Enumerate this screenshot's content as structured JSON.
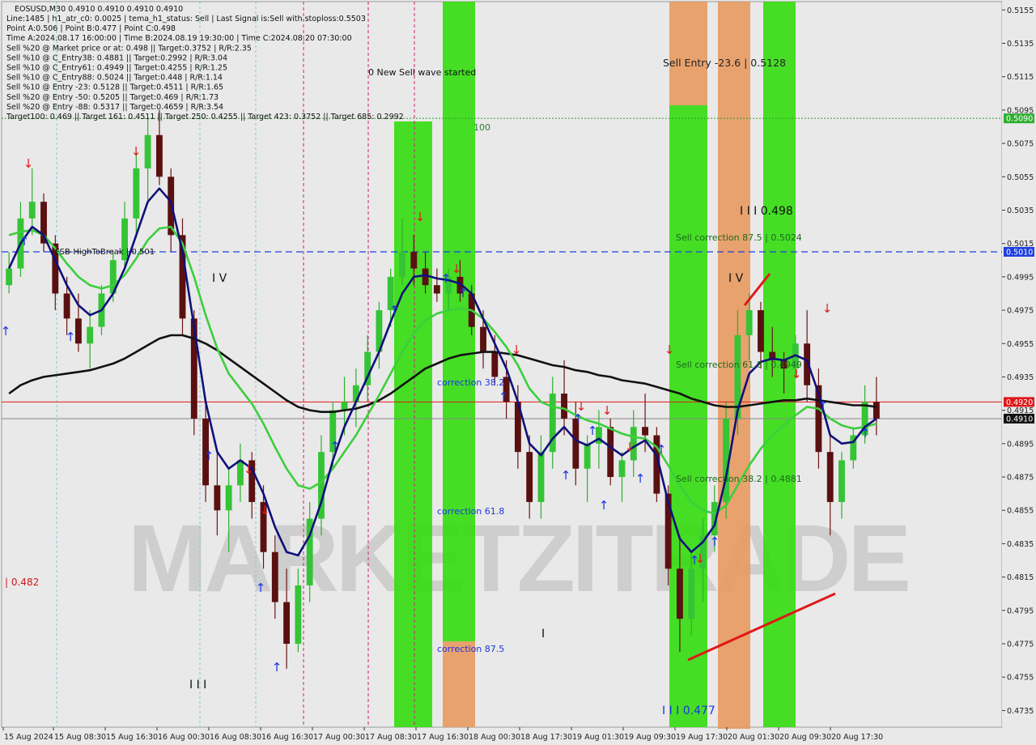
{
  "info": {
    "symbol_line": "EOSUSD,M30  0.4910 0.4910 0.4910 0.4910",
    "lines": [
      "Line:1485  |  h1_atr_c0: 0.0025  |  tema_h1_status: Sell  |  Last Signal is:Sell with stoploss:0.5503",
      "Point A:0.506  |  Point B:0.477  |  Point C:0.498",
      "Time A:2024.08.17 16:00:00  |  Time B:2024.08.19 19:30:00  |  Time C:2024.08.20 07:30:00",
      "Sell %20 @ Market price or at: 0.498  ||  Target:0.3752  |  R/R:2.35",
      "Sell %10 @ C_Entry38: 0.4881  ||  Target:0.2992  |  R/R:3.04",
      "Sell %10 @ C_Entry61: 0.4949  ||  Target:0.4255  |  R/R:1.25",
      "Sell %10 @ C_Entry88: 0.5024  ||  Target:0.448  |  R/R:1.14",
      "Sell %10 @ Entry -23: 0.5128  ||  Target:0.4511  |  R/R:1.65",
      "Sell %20 @ Entry -50: 0.5205  ||  Target:0.469  |  R/R:1.73",
      "Sell %20 @ Entry -88: 0.5317  ||  Target:0.4659  |  R/R:3.54",
      "Target100: 0.469  ||  Target 161: 0.4511  ||  Target 250: 0.4255  ||  Target 423: 0.3752  ||  Target 685: 0.2992"
    ]
  },
  "annotations": {
    "new_wave": "0 New Sell wave started",
    "sell_entry": "Sell Entry -23.6 | 0.5128",
    "label_100": "100",
    "wave_iii_high": "I I I 0.498",
    "sell_corr_875": "Sell correction 87.5 | 0.5024",
    "iv_left": "I V",
    "iv_right": "I V",
    "sell_corr_618": "Sell correction 61.8 | 0.4949",
    "sell_corr_382": "Sell correction 38.2 | 0.4881",
    "fsb_high": "FSB-HighToBreak | 0.501",
    "corr_382": "correction 38.2",
    "corr_618": "correction 61.8",
    "corr_875": "correction 87.5",
    "left_482": "| 0.482",
    "iii_left": "I I I",
    "iii_bottom": "I I I 0.477",
    "i_mark": "I",
    "watermark": "MARKETZITRADE"
  },
  "chart_data": {
    "type": "candlestick",
    "symbol": "EOSUSD",
    "timeframe": "M30",
    "ylim": [
      0.4725,
      0.516
    ],
    "y_ticks": [
      "0.5155",
      "0.5135",
      "0.5115",
      "0.5095",
      "0.5075",
      "0.5055",
      "0.5035",
      "0.5015",
      "0.4995",
      "0.4975",
      "0.4955",
      "0.4935",
      "0.4915",
      "0.4895",
      "0.4875",
      "0.4855",
      "0.4835",
      "0.4815",
      "0.4795",
      "0.4775",
      "0.4755",
      "0.4735"
    ],
    "x_ticks": [
      "15 Aug 2024",
      "15 Aug 08:30",
      "15 Aug 16:30",
      "16 Aug 00:30",
      "16 Aug 08:30",
      "16 Aug 16:30",
      "17 Aug 00:30",
      "17 Aug 08:30",
      "17 Aug 16:30",
      "18 Aug 00:30",
      "18 Aug 17:30",
      "19 Aug 01:30",
      "19 Aug 09:30",
      "19 Aug 17:30",
      "20 Aug 01:30",
      "20 Aug 09:30",
      "20 Aug 17:30"
    ],
    "price_tags": [
      {
        "text": "0.5090",
        "value": 0.509,
        "bg": "#2fae2f"
      },
      {
        "text": "0.5010",
        "value": 0.501,
        "bg": "#1f3fe0"
      },
      {
        "text": "0.4920",
        "value": 0.492,
        "bg": "#e01818"
      },
      {
        "text": "0.4910",
        "value": 0.491,
        "bg": "#111111"
      }
    ],
    "levels": [
      {
        "name": "level-0.5090",
        "value": 0.509,
        "color": "#2e9b2e",
        "style": "dotted"
      },
      {
        "name": "fsb-high-line",
        "value": 0.501,
        "color": "#1f3fe0",
        "style": "dashed"
      },
      {
        "name": "level-0.4920",
        "value": 0.492,
        "color": "#e01818",
        "style": "solid"
      },
      {
        "name": "level-0.4910",
        "value": 0.491,
        "color": "#888888",
        "style": "solid"
      }
    ],
    "candles": [
      [
        0.499,
        0.501,
        0.4985,
        0.5
      ],
      [
        0.5,
        0.504,
        0.4995,
        0.503
      ],
      [
        0.503,
        0.506,
        0.502,
        0.504
      ],
      [
        0.504,
        0.5045,
        0.501,
        0.5015
      ],
      [
        0.5015,
        0.502,
        0.4975,
        0.4985
      ],
      [
        0.4985,
        0.4995,
        0.496,
        0.497
      ],
      [
        0.497,
        0.4985,
        0.495,
        0.4955
      ],
      [
        0.4955,
        0.4975,
        0.494,
        0.4965
      ],
      [
        0.4965,
        0.499,
        0.496,
        0.4985
      ],
      [
        0.4985,
        0.501,
        0.498,
        0.5005
      ],
      [
        0.5005,
        0.504,
        0.5,
        0.503
      ],
      [
        0.503,
        0.507,
        0.502,
        0.506
      ],
      [
        0.506,
        0.509,
        0.504,
        0.508
      ],
      [
        0.508,
        0.5095,
        0.505,
        0.5055
      ],
      [
        0.5055,
        0.506,
        0.501,
        0.502
      ],
      [
        0.502,
        0.503,
        0.496,
        0.497
      ],
      [
        0.497,
        0.4975,
        0.49,
        0.491
      ],
      [
        0.491,
        0.492,
        0.486,
        0.487
      ],
      [
        0.487,
        0.489,
        0.484,
        0.4855
      ],
      [
        0.4855,
        0.488,
        0.483,
        0.487
      ],
      [
        0.487,
        0.4895,
        0.486,
        0.4885
      ],
      [
        0.4885,
        0.489,
        0.485,
        0.486
      ],
      [
        0.486,
        0.487,
        0.482,
        0.483
      ],
      [
        0.483,
        0.484,
        0.479,
        0.48
      ],
      [
        0.48,
        0.482,
        0.476,
        0.4775
      ],
      [
        0.4775,
        0.482,
        0.477,
        0.481
      ],
      [
        0.481,
        0.486,
        0.48,
        0.485
      ],
      [
        0.485,
        0.49,
        0.484,
        0.489
      ],
      [
        0.489,
        0.492,
        0.488,
        0.4915
      ],
      [
        0.4915,
        0.4935,
        0.49,
        0.492
      ],
      [
        0.492,
        0.494,
        0.4905,
        0.493
      ],
      [
        0.493,
        0.496,
        0.492,
        0.495
      ],
      [
        0.495,
        0.498,
        0.494,
        0.4975
      ],
      [
        0.4975,
        0.5,
        0.4965,
        0.4995
      ],
      [
        0.4995,
        0.503,
        0.499,
        0.501
      ],
      [
        0.501,
        0.502,
        0.499,
        0.5
      ],
      [
        0.5,
        0.501,
        0.4985,
        0.499
      ],
      [
        0.499,
        0.5,
        0.498,
        0.4985
      ],
      [
        0.4985,
        0.5,
        0.4975,
        0.4995
      ],
      [
        0.4995,
        0.5005,
        0.498,
        0.4985
      ],
      [
        0.4985,
        0.499,
        0.496,
        0.4965
      ],
      [
        0.4965,
        0.4975,
        0.494,
        0.495
      ],
      [
        0.495,
        0.496,
        0.493,
        0.4935
      ],
      [
        0.4935,
        0.4945,
        0.491,
        0.492
      ],
      [
        0.492,
        0.493,
        0.488,
        0.489
      ],
      [
        0.489,
        0.49,
        0.485,
        0.486
      ],
      [
        0.486,
        0.49,
        0.485,
        0.489
      ],
      [
        0.489,
        0.4935,
        0.488,
        0.4925
      ],
      [
        0.4925,
        0.4945,
        0.49,
        0.491
      ],
      [
        0.491,
        0.492,
        0.487,
        0.488
      ],
      [
        0.488,
        0.49,
        0.486,
        0.4895
      ],
      [
        0.4895,
        0.4915,
        0.488,
        0.4905
      ],
      [
        0.4905,
        0.491,
        0.487,
        0.4875
      ],
      [
        0.4875,
        0.489,
        0.486,
        0.4885
      ],
      [
        0.4885,
        0.4915,
        0.4875,
        0.4905
      ],
      [
        0.4905,
        0.4925,
        0.489,
        0.49
      ],
      [
        0.49,
        0.4905,
        0.486,
        0.4865
      ],
      [
        0.4865,
        0.487,
        0.481,
        0.482
      ],
      [
        0.482,
        0.484,
        0.477,
        0.479
      ],
      [
        0.479,
        0.483,
        0.478,
        0.482
      ],
      [
        0.482,
        0.485,
        0.48,
        0.484
      ],
      [
        0.484,
        0.487,
        0.483,
        0.486
      ],
      [
        0.486,
        0.492,
        0.485,
        0.491
      ],
      [
        0.491,
        0.4975,
        0.49,
        0.496
      ],
      [
        0.496,
        0.4985,
        0.4945,
        0.4975
      ],
      [
        0.4975,
        0.498,
        0.494,
        0.495
      ],
      [
        0.495,
        0.4965,
        0.4935,
        0.4945
      ],
      [
        0.4945,
        0.495,
        0.4925,
        0.494
      ],
      [
        0.494,
        0.496,
        0.4935,
        0.4955
      ],
      [
        0.4955,
        0.4975,
        0.492,
        0.493
      ],
      [
        0.493,
        0.494,
        0.488,
        0.489
      ],
      [
        0.489,
        0.49,
        0.484,
        0.486
      ],
      [
        0.486,
        0.489,
        0.485,
        0.4885
      ],
      [
        0.4885,
        0.4905,
        0.488,
        0.49
      ],
      [
        0.49,
        0.493,
        0.4895,
        0.492
      ],
      [
        0.492,
        0.4935,
        0.49,
        0.491
      ]
    ],
    "ema_fast_dark_blue": [
      0.5,
      0.5015,
      0.5025,
      0.502,
      0.5005,
      0.499,
      0.4978,
      0.4972,
      0.4975,
      0.4985,
      0.5,
      0.502,
      0.504,
      0.5048,
      0.504,
      0.501,
      0.4965,
      0.492,
      0.489,
      0.488,
      0.4885,
      0.488,
      0.4865,
      0.4845,
      0.483,
      0.4828,
      0.484,
      0.486,
      0.4885,
      0.4905,
      0.492,
      0.4935,
      0.495,
      0.4968,
      0.4985,
      0.4995,
      0.4996,
      0.4994,
      0.4993,
      0.4991,
      0.4985,
      0.497,
      0.4955,
      0.494,
      0.492,
      0.4895,
      0.4888,
      0.4898,
      0.4905,
      0.4897,
      0.4894,
      0.4898,
      0.4893,
      0.4888,
      0.4893,
      0.4897,
      0.4888,
      0.486,
      0.4838,
      0.483,
      0.4836,
      0.4846,
      0.4875,
      0.4915,
      0.4937,
      0.4944,
      0.4946,
      0.4945,
      0.4948,
      0.4945,
      0.4925,
      0.49,
      0.4895,
      0.4896,
      0.4905,
      0.491
    ],
    "ema_mid_green": [
      0.502,
      0.5022,
      0.5023,
      0.502,
      0.5012,
      0.5003,
      0.4995,
      0.499,
      0.4988,
      0.499,
      0.4996,
      0.5006,
      0.5017,
      0.5024,
      0.5025,
      0.5015,
      0.4995,
      0.4972,
      0.4952,
      0.4937,
      0.4928,
      0.4919,
      0.4907,
      0.4893,
      0.488,
      0.487,
      0.4868,
      0.4872,
      0.488,
      0.489,
      0.49,
      0.4912,
      0.4924,
      0.4937,
      0.495,
      0.4961,
      0.4969,
      0.4973,
      0.4975,
      0.4976,
      0.4975,
      0.497,
      0.4962,
      0.4953,
      0.4942,
      0.4928,
      0.492,
      0.4917,
      0.4916,
      0.4912,
      0.4909,
      0.4907,
      0.4904,
      0.4901,
      0.4899,
      0.4898,
      0.4893,
      0.4882,
      0.487,
      0.486,
      0.4855,
      0.4853,
      0.4858,
      0.487,
      0.4882,
      0.4892,
      0.49,
      0.4906,
      0.4912,
      0.4917,
      0.4916,
      0.491,
      0.4906,
      0.4904,
      0.4905,
      0.4907
    ],
    "sma_slow_black": [
      0.4925,
      0.493,
      0.4933,
      0.4935,
      0.4936,
      0.4937,
      0.4938,
      0.4939,
      0.4941,
      0.4943,
      0.4946,
      0.495,
      0.4954,
      0.4958,
      0.496,
      0.496,
      0.4958,
      0.4955,
      0.4951,
      0.4946,
      0.4941,
      0.4936,
      0.4931,
      0.4926,
      0.4921,
      0.4917,
      0.4915,
      0.4914,
      0.4914,
      0.4915,
      0.4916,
      0.4918,
      0.4921,
      0.4925,
      0.493,
      0.4935,
      0.494,
      0.4943,
      0.4946,
      0.4948,
      0.4949,
      0.495,
      0.495,
      0.4949,
      0.4948,
      0.4946,
      0.4944,
      0.4942,
      0.4941,
      0.4939,
      0.4938,
      0.4936,
      0.4935,
      0.4933,
      0.4932,
      0.4931,
      0.4929,
      0.4927,
      0.4925,
      0.4922,
      0.492,
      0.4918,
      0.4917,
      0.4917,
      0.4918,
      0.4919,
      0.492,
      0.4921,
      0.4921,
      0.4922,
      0.4921,
      0.492,
      0.4919,
      0.4918,
      0.4918,
      0.4917
    ]
  }
}
